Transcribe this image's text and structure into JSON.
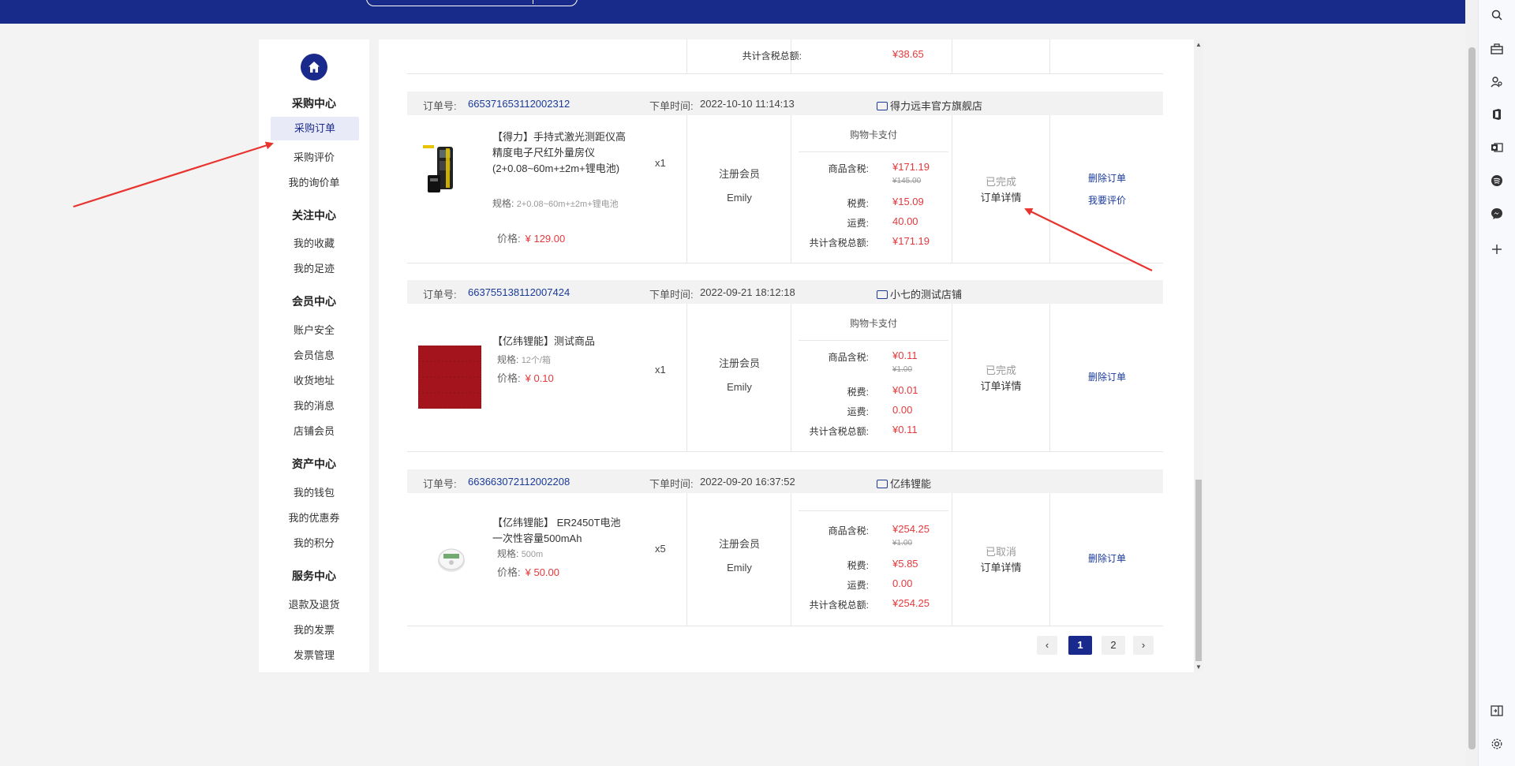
{
  "nav": {
    "groups": [
      {
        "title": "采购中心",
        "items": [
          "采购订单",
          "采购评价",
          "我的询价单"
        ]
      },
      {
        "title": "关注中心",
        "items": [
          "我的收藏",
          "我的足迹"
        ]
      },
      {
        "title": "会员中心",
        "items": [
          "账户安全",
          "会员信息",
          "收货地址",
          "我的消息",
          "店铺会员"
        ]
      },
      {
        "title": "资产中心",
        "items": [
          "我的钱包",
          "我的优惠券",
          "我的积分"
        ]
      },
      {
        "title": "服务中心",
        "items": [
          "退款及退货",
          "我的发票",
          "发票管理"
        ]
      }
    ],
    "active_item": "采购订单"
  },
  "partial_order": {
    "total_label": "共计含税总额:",
    "total_value": "¥38.65"
  },
  "orders": [
    {
      "no_label": "订单号:",
      "no": "665371653112002312",
      "time_label": "下单时间:",
      "time": "2022-10-10 11:14:13",
      "store": "得力远丰官方旗舰店",
      "product_name": "【得力】手持式激光测距仪高精度电子尺红外量房仪(2+0.08~60m+±2m+锂电池)",
      "spec_label": "规格:",
      "spec": "2+0.08~60m+±2m+锂电池",
      "price_label": "价格:",
      "price": "¥ 129.00",
      "qty": "x1",
      "buyer_type": "注册会员",
      "buyer_name": "Emily",
      "pay_type": "购物卡支付",
      "goods_label": "商品含税:",
      "goods_value": "¥171.19",
      "goods_original": "¥145.00",
      "tax_label": "税费:",
      "tax_value": "¥15.09",
      "shipping_label": "运费:",
      "shipping_value": "40.00",
      "total_label": "共计含税总额:",
      "total_value": "¥171.19",
      "status": "已完成",
      "detail": "订单详情",
      "ops": [
        "删除订单",
        "我要评价"
      ]
    },
    {
      "no_label": "订单号:",
      "no": "663755138112007424",
      "time_label": "下单时间:",
      "time": "2022-09-21 18:12:18",
      "store": "小七的测试店铺",
      "product_name": "【亿纬锂能】测试商品",
      "spec_label": "规格:",
      "spec": "12个/箱",
      "price_label": "价格:",
      "price": "¥ 0.10",
      "qty": "x1",
      "buyer_type": "注册会员",
      "buyer_name": "Emily",
      "pay_type": "购物卡支付",
      "goods_label": "商品含税:",
      "goods_value": "¥0.11",
      "goods_original": "¥1.00",
      "tax_label": "税费:",
      "tax_value": "¥0.01",
      "shipping_label": "运费:",
      "shipping_value": "0.00",
      "total_label": "共计含税总额:",
      "total_value": "¥0.11",
      "status": "已完成",
      "detail": "订单详情",
      "ops": [
        "删除订单"
      ]
    },
    {
      "no_label": "订单号:",
      "no": "663663072112002208",
      "time_label": "下单时间:",
      "time": "2022-09-20 16:37:52",
      "store": "亿纬锂能",
      "product_name": "【亿纬锂能】 ER2450T电池一次性容量500mAh",
      "spec_label": "规格:",
      "spec": "500m",
      "price_label": "价格:",
      "price": "¥ 50.00",
      "qty": "x5",
      "buyer_type": "注册会员",
      "buyer_name": "Emily",
      "goods_label": "商品含税:",
      "goods_value": "¥254.25",
      "goods_original": "¥1.00",
      "tax_label": "税费:",
      "tax_value": "¥5.85",
      "shipping_label": "运费:",
      "shipping_value": "0.00",
      "total_label": "共计含税总额:",
      "total_value": "¥254.25",
      "status": "已取消",
      "detail": "订单详情",
      "ops": [
        "删除订单"
      ]
    }
  ],
  "pagination": {
    "prev": "‹",
    "pages": [
      "1",
      "2"
    ],
    "current": "1",
    "next": "›"
  },
  "edge_icons": [
    "search-icon",
    "briefcase-icon",
    "user-icon",
    "office-icon",
    "outlook-icon",
    "spotify-icon",
    "messenger-icon",
    "add-icon",
    "sidebar-toggle-icon",
    "settings-icon"
  ],
  "colors": {
    "header_bg": "#182a8a",
    "accent": "#1a2a8c",
    "link": "#1a3a9a",
    "price_red": "#e4393c",
    "arrow_red": "#e8332e"
  }
}
